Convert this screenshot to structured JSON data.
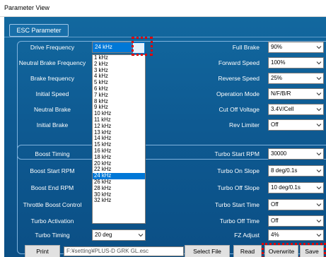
{
  "window": {
    "title": "Parameter View"
  },
  "tab": {
    "label": "ESC Parameter"
  },
  "left_params": [
    {
      "label": "Drive Frequency",
      "value": "24 kHz"
    },
    {
      "label": "Neutral Brake Frequency",
      "value": ""
    },
    {
      "label": "Brake frequency",
      "value": ""
    },
    {
      "label": "Initial Speed",
      "value": ""
    },
    {
      "label": "Neutral Brake",
      "value": ""
    },
    {
      "label": "Initial Brake",
      "value": ""
    }
  ],
  "right_params": [
    {
      "label": "Full Brake",
      "value": "90%"
    },
    {
      "label": "Forward Speed",
      "value": "100%"
    },
    {
      "label": "Reverse Speed",
      "value": "25%"
    },
    {
      "label": "Operation Mode",
      "value": "N/F/B/R"
    },
    {
      "label": "Cut Off Voltage",
      "value": "3.4V/Cell"
    },
    {
      "label": "Rev Limiter",
      "value": "Off"
    }
  ],
  "left_params2": [
    {
      "label": "Boost Timing",
      "value": ""
    },
    {
      "label": "Boost Start RPM",
      "value": ""
    },
    {
      "label": "Boost End RPM",
      "value": ""
    },
    {
      "label": "Throttle Boost Control",
      "value": ""
    },
    {
      "label": "Turbo Activation",
      "value": ""
    },
    {
      "label": "Turbo Timing",
      "value": "20 deg"
    }
  ],
  "right_params2": [
    {
      "label": "Turbo Start RPM",
      "value": "30000"
    },
    {
      "label": "Turbo On Slope",
      "value": "8 deg/0.1s"
    },
    {
      "label": "Turbo Off Slope",
      "value": "10 deg/0.1s"
    },
    {
      "label": "Turbo Start Time",
      "value": "Off"
    },
    {
      "label": "Turbo Off Time",
      "value": "Off"
    },
    {
      "label": "FZ Adjust",
      "value": "4%"
    }
  ],
  "dropdown_options": [
    "1 kHz",
    "2 kHz",
    "3 kHz",
    "4 kHz",
    "5 kHz",
    "6 kHz",
    "7 kHz",
    "8 kHz",
    "9 kHz",
    "10 kHz",
    "11 kHz",
    "12 kHz",
    "13 kHz",
    "14 kHz",
    "15 kHz",
    "16 kHz",
    "18 kHz",
    "20 kHz",
    "22 kHz",
    "24 kHz",
    "26 kHz",
    "28 kHz",
    "30 kHz",
    "32 kHz"
  ],
  "dropdown_selected": "24 kHz",
  "footer": {
    "print_label": "Print",
    "path": "F:¥setting¥PLUS-D GRK GL.esc",
    "select_file_label": "Select File",
    "read_label": "Read",
    "overwrite_label": "Overwrite",
    "save_label": "Save"
  },
  "colors": {
    "accent": "#0078d7",
    "highlight_box": "#e00000",
    "background": "#0e5a92"
  },
  "icons": {
    "combo_arrow": "chevron-down-icon"
  }
}
